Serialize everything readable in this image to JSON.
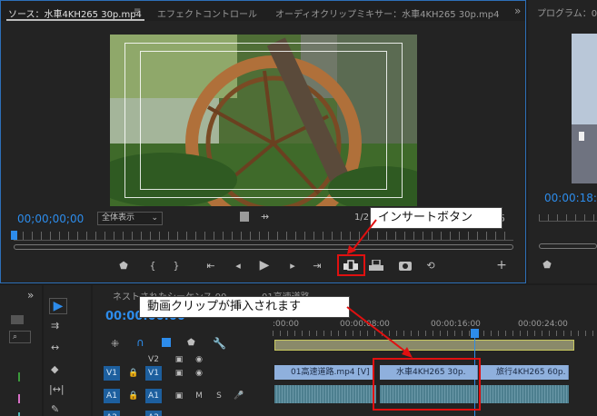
{
  "source_monitor": {
    "tabs": [
      {
        "label": "ソース：水車4KH265 30p.mp4"
      },
      {
        "label": "エフェクトコントロール"
      },
      {
        "label": "オーディオクリップミキサー：水車4KH265 30p.mp4"
      }
    ],
    "menu_glyph": "≡",
    "overflow_glyph": "»",
    "timecode": "00;00;00;00",
    "zoom_select": "全体表示",
    "resolution_partial": "1/2",
    "duration_partial": "5"
  },
  "program_monitor": {
    "tab_label": "プログラム：01",
    "timecode_partial": "00:00:18:0"
  },
  "timeline": {
    "tab_label_partial": "ネストされたシーケンス 00",
    "tab2_label_partial": "01高速道路",
    "timecode_partial": "00:00:00:00",
    "ruler": [
      ":00:00",
      "00:00:08:00",
      "00:00:16:00",
      "00:00:24:00"
    ],
    "tracks": [
      {
        "name": "V2",
        "target": "V2"
      },
      {
        "name": "V1",
        "target": "V1"
      },
      {
        "name": "A1",
        "target": "A1"
      },
      {
        "name": "A2",
        "target": "A2"
      }
    ],
    "mute": "M",
    "solo": "S",
    "video_clips": [
      {
        "label": "01高速道路.mp4 [V]"
      },
      {
        "label": "水車4KH265 30p."
      },
      {
        "label": "旅行4KH265 60p."
      }
    ]
  },
  "callouts": {
    "insert": "インサートボタン",
    "inserted": "動画クリップが挿入されます"
  },
  "colors": {
    "accent": "#2d8ceb",
    "highlight": "#e01010"
  }
}
